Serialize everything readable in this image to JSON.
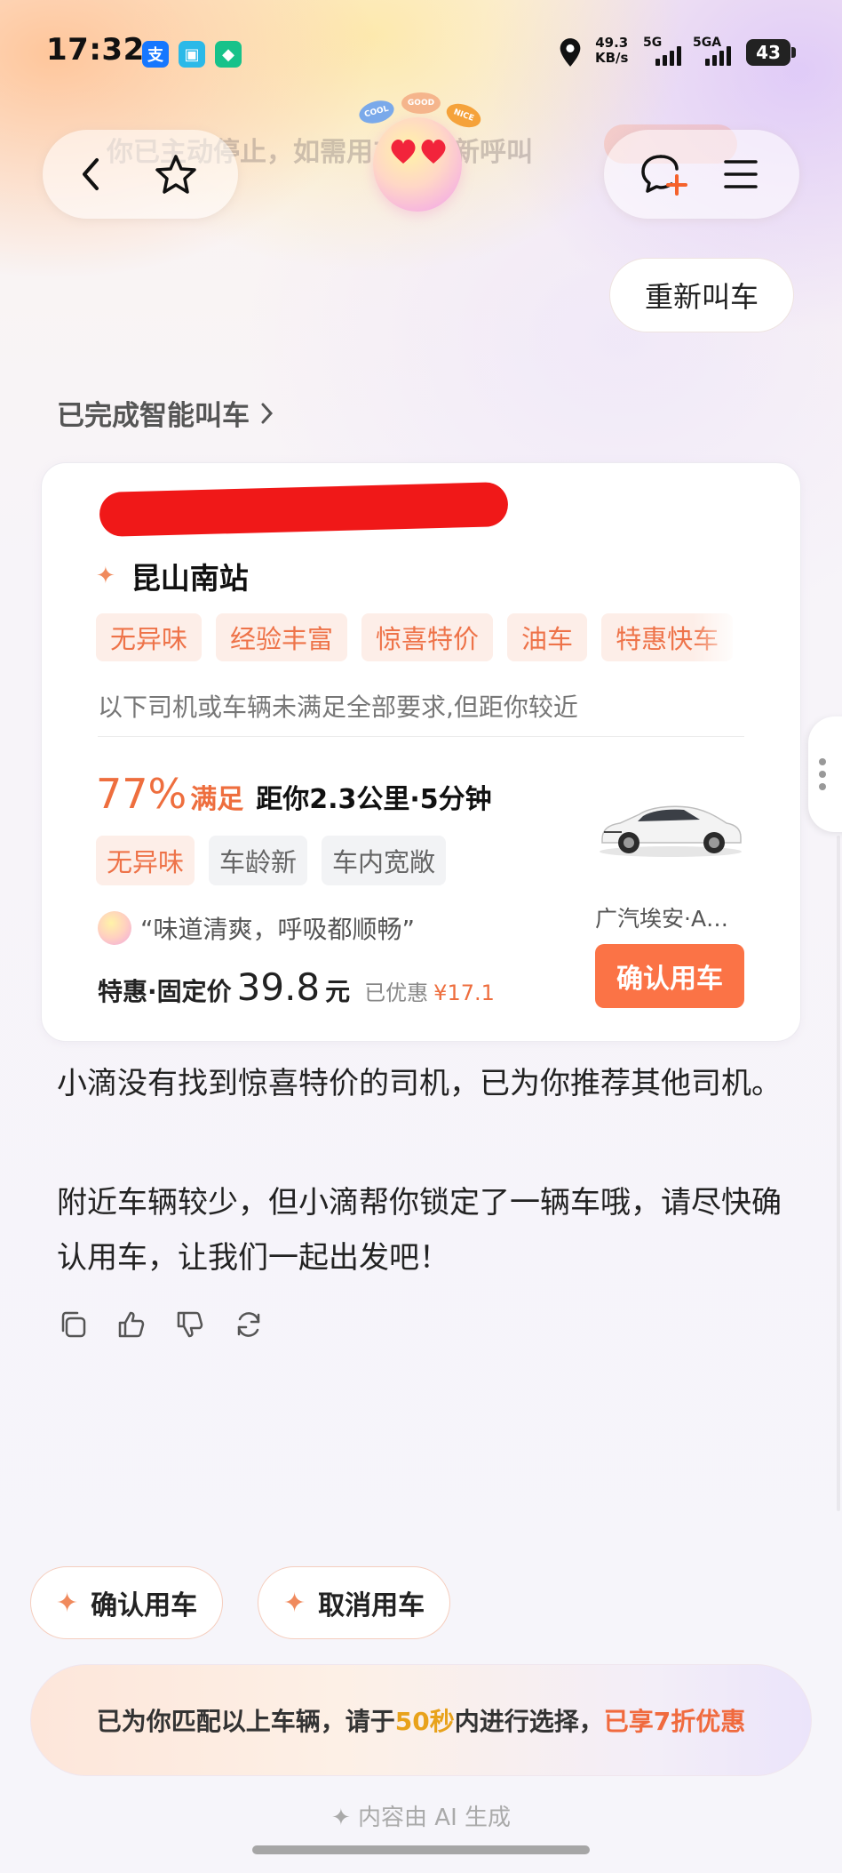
{
  "status_bar": {
    "time": "17:32",
    "app_icons": [
      {
        "name": "alipay-icon",
        "glyph": "支",
        "color": "#1677ff"
      },
      {
        "name": "message-app-icon",
        "glyph": "▣",
        "color": "#2bb9e8"
      },
      {
        "name": "green-app-icon",
        "glyph": "◆",
        "color": "#17c28a"
      }
    ],
    "net_speed_value": "49.3",
    "net_speed_unit": "KB/s",
    "signal_1": "5G",
    "signal_2": "5GA",
    "battery": "43"
  },
  "header": {
    "ghost_text": "你已主动停止，如需用车请重新呼叫",
    "mascot_bubbles": [
      "COOL",
      "GOOD",
      "NICE"
    ]
  },
  "renew_button": "重新叫车",
  "section_label": "已完成智能叫车",
  "card": {
    "destination": "昆山南站",
    "destination_marker": "✦",
    "preference_tags": [
      "无异味",
      "经验丰富",
      "惊喜特价",
      "油车",
      "特惠快车"
    ],
    "note": "以下司机或车辆未满足全部要求,但距你较近",
    "match_percent": "77%",
    "match_label": "满足",
    "distance_text": "距你2.3公里·5分钟",
    "driver_tags": [
      {
        "label": "无异味",
        "matched": true
      },
      {
        "label": "车龄新",
        "matched": false
      },
      {
        "label": "车内宽敞",
        "matched": false
      }
    ],
    "quote": "“味道清爽，呼吸都顺畅”",
    "price_label": "特惠·固定价",
    "price_value": "39.8",
    "price_unit": "元",
    "discount_label": "已优惠",
    "discount_value": "¥17.1",
    "car_name": "广汽埃安·A…",
    "confirm_button": "确认用车"
  },
  "messages": [
    "小滴没有找到惊喜特价的司机，已为你推荐其他司机。",
    "附近车辆较少，但小滴帮你锁定了一辆车哦，请尽快确认用车，让我们一起出发吧！"
  ],
  "message_actions": [
    "copy-icon",
    "thumbs-up-icon",
    "thumbs-down-icon",
    "refresh-icon"
  ],
  "quick_actions": {
    "confirm": "确认用车",
    "cancel": "取消用车"
  },
  "footer": {
    "part1": "已为你匹配以上车辆，请于",
    "seconds": "50秒",
    "part2": "内进行选择，",
    "offer": "已享7折优惠"
  },
  "ai_note": "✦ 内容由 AI 生成",
  "colors": {
    "accent": "#fb7346",
    "tag_bg": "#fdeee8",
    "countdown": "#e8a21b"
  }
}
